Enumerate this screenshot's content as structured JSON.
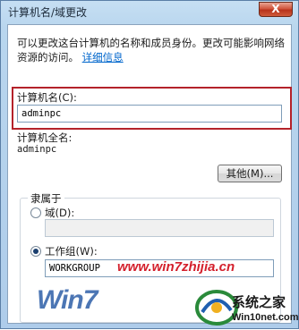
{
  "window": {
    "title": "计算机名/域更改",
    "close_label": "X"
  },
  "description": {
    "text": "可以更改这台计算机的名称和成员身份。更改可能影响网络资源的访问。",
    "link": "详细信息"
  },
  "computer_name": {
    "label": "计算机名(C):",
    "value": "adminpc"
  },
  "full_name": {
    "label": "计算机全名:",
    "value": "adminpc"
  },
  "more_button": "其他(M)...",
  "member_of": {
    "group_label": "隶属于",
    "domain_radio": "域(D):",
    "domain_value": "",
    "workgroup_radio": "工作组(W):",
    "workgroup_value": "WORKGROUP",
    "selected": "workgroup"
  },
  "watermark": {
    "url": "www.win7zhijia.cn",
    "brand": "系统之家",
    "brand_sub": "Win10net.com",
    "logo_text": "Win7"
  }
}
